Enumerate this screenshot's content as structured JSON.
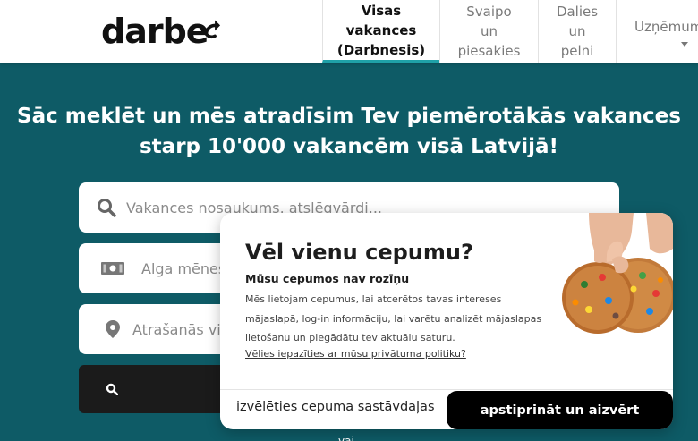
{
  "brand": {
    "logo_text": "darbe"
  },
  "nav": {
    "items": [
      {
        "label": "Visas vakances (Darbnesis)",
        "lines": [
          "Visas",
          "vakances",
          "(Darbnesis)"
        ]
      },
      {
        "label": "Svaipo un piesakies",
        "lines": [
          "Svaipo",
          "un",
          "piesakies"
        ]
      },
      {
        "label": "Dalies un pelni",
        "lines": [
          "Dalies",
          "un",
          "pelni"
        ]
      },
      {
        "label": "Uzņēmumi",
        "lines": [
          "Uzņēmumi"
        ]
      }
    ]
  },
  "hero": {
    "title_line1": "Sāc meklēt un mēs atradīsim Tev piemērotākās vakances",
    "title_line2": "starp 10'000 vakancēm visā Latvijā!"
  },
  "search": {
    "keyword_placeholder": "Vakances nosaukums, atslēgvārdi...",
    "salary_placeholder": "Alga mēnesī",
    "location_placeholder": "Atrašanās vieta"
  },
  "footer_hint": "vai",
  "cookie": {
    "title": "Vēl vienu cepumu?",
    "subtitle": "Mūsu cepumos nav rozīņu",
    "body": "Mēs lietojam cepumus, lai atcerētos tavas intereses mājaslapā, log-in informāciju, lai varētu analizēt mājaslapas lietošanu un piegādātu tev aktuālu saturu.",
    "link": "Vēlies iepazīties ar mūsu privātuma politiku?",
    "btn_ingredients": "izvēlēties cepuma sastāvdaļas",
    "btn_confirm": "apstiprināt un aizvērt"
  },
  "colors": {
    "hero_bg": "#0e5b66",
    "active_tab_underline": "#1fa1a8",
    "confirm_button": "#000000"
  },
  "icons": [
    "arrow-up-logo-icon",
    "search-icon",
    "money-icon",
    "location-pin-icon",
    "search-button-icon",
    "cookie-image"
  ]
}
